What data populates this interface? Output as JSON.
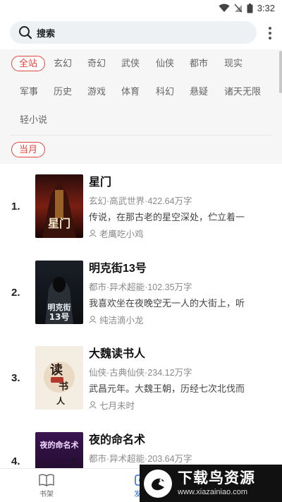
{
  "status": {
    "time": "3:32"
  },
  "search": {
    "label": "搜索"
  },
  "filters": {
    "genres": [
      "全站",
      "玄幻",
      "奇幻",
      "武侠",
      "仙侠",
      "都市",
      "现实",
      "军事",
      "历史",
      "游戏",
      "体育",
      "科幻",
      "悬疑",
      "诸天无限",
      "轻小说"
    ],
    "period": "当月"
  },
  "books": [
    {
      "rank": "1.",
      "title": "星门",
      "meta": "玄幻·高武世界·422.64万字",
      "desc": "传说，在那古老的星空深处，伫立着一",
      "author": "老鹰吃小鸡",
      "cover_text": "星门"
    },
    {
      "rank": "2.",
      "title": "明克街13号",
      "meta": "都市·异术超能·102.35万字",
      "desc": "我喜欢坐在夜晚空无一人的大街上，听",
      "author": "纯洁滴小龙",
      "cover_text": "明克街13号"
    },
    {
      "rank": "3.",
      "title": "大魏读书人",
      "meta": "仙侠·古典仙侠·234.12万字",
      "desc": "武昌元年。大魏王朝，历经七次北伐而",
      "author": "七月未时",
      "cover_text": "读书人"
    },
    {
      "rank": "4.",
      "title": "夜的命名术",
      "meta": "都市·异术超能·203.64万字",
      "desc": "",
      "author": "",
      "cover_text": "夜的命名术"
    }
  ],
  "tabbar": {
    "tabs": [
      "书架",
      "发现"
    ]
  },
  "watermark": {
    "title": "下载鸟资源",
    "url": "www.xiazainiao.com"
  },
  "colors": {
    "accent_red": "#e3453b",
    "accent_blue": "#2c6fd6"
  }
}
